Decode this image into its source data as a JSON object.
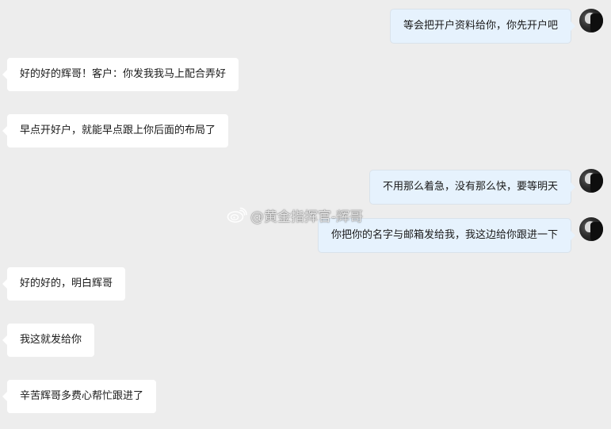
{
  "chat": {
    "messages": [
      {
        "side": "right",
        "text": "等会把开户资料给你，你先开户吧"
      },
      {
        "side": "left",
        "text": "好的好的辉哥！客户：你发我我马上配合弄好"
      },
      {
        "side": "left",
        "text": "早点开好户，就能早点跟上你后面的布局了"
      },
      {
        "side": "right",
        "text": "不用那么着急，没有那么快，要等明天"
      },
      {
        "side": "right",
        "text": "你把你的名字与邮箱发给我，我这边给你跟进一下"
      },
      {
        "side": "left",
        "text": "好的好的，明白辉哥"
      },
      {
        "side": "left",
        "text": "我这就发给你"
      },
      {
        "side": "left",
        "text": "辛苦辉哥多费心帮忙跟进了"
      }
    ]
  },
  "watermark": {
    "text": "@黄金指挥官-辉哥",
    "icon": "weibo-icon"
  },
  "colors": {
    "background": "#ededed",
    "bubble_left": "#ffffff",
    "bubble_right": "#e6f2fd"
  }
}
